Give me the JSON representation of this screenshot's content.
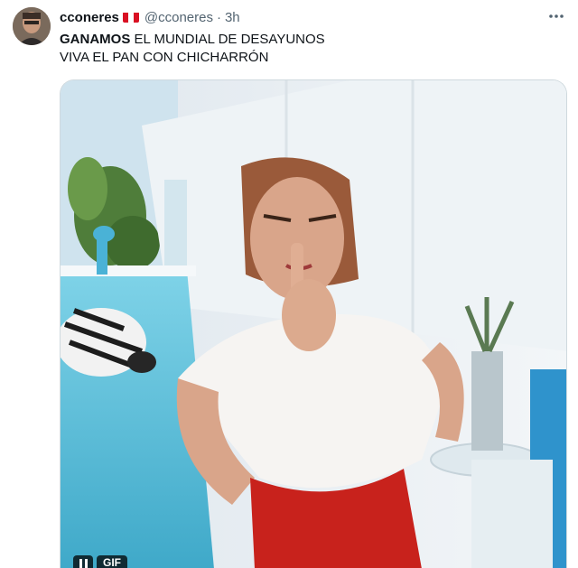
{
  "author": {
    "display_name": "cconeres",
    "handle": "@cconeres",
    "separator": "·",
    "time": "3h"
  },
  "tweet": {
    "line1_bold": "GANAMOS",
    "line1_rest": " EL MUNDIAL DE DESAYUNOS",
    "line2": "VIVA EL PAN CON CHICHARRÓN"
  },
  "media": {
    "badge": "GIF"
  },
  "icons": {
    "flag": "peru-flag-icon",
    "more": "more-icon",
    "pause": "pause-icon"
  },
  "colors": {
    "text": "#0f1419",
    "secondary_text": "#536471",
    "flag_red": "#d91023"
  }
}
